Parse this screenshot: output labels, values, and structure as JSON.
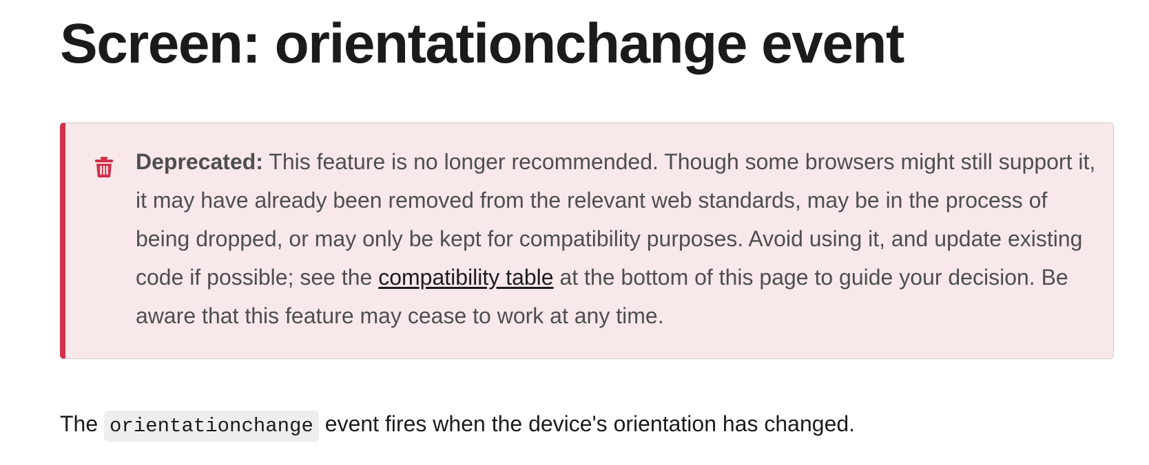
{
  "page": {
    "title": "Screen: orientationchange event"
  },
  "notice": {
    "icon": "trash-icon",
    "accent_color": "#d0304a",
    "background_color": "#f8e8ea",
    "label": "Deprecated:",
    "text_before_link": " This feature is no longer recommended. Though some browsers might still support it, it may have already been removed from the relevant web standards, may be in the process of being dropped, or may only be kept for compatibility purposes. Avoid using it, and update existing code if possible; see the ",
    "link_text": "compatibility table",
    "text_after_link": " at the bottom of this page to guide your decision. Be aware that this feature may cease to work at any time."
  },
  "intro": {
    "text_before_code": "The ",
    "code": "orientationchange",
    "text_after_code": " event fires when the device's orientation has changed."
  }
}
